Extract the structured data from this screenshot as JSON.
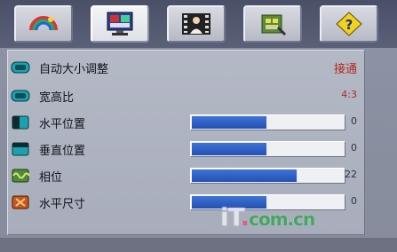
{
  "tabs": [
    {
      "name": "color",
      "icon": "color-wheel-icon",
      "active": false
    },
    {
      "name": "image",
      "icon": "monitor-icon",
      "active": true
    },
    {
      "name": "video",
      "icon": "film-person-icon",
      "active": false
    },
    {
      "name": "setup",
      "icon": "settings-chip-icon",
      "active": false
    },
    {
      "name": "help",
      "icon": "help-question-icon",
      "active": false
    }
  ],
  "rows": [
    {
      "label": "自动大小调整",
      "icon": "auto-resize-icon",
      "value": "接通"
    },
    {
      "label": "宽高比",
      "icon": "aspect-ratio-icon",
      "value": "4:3"
    },
    {
      "label": "水平位置",
      "icon": "h-position-icon",
      "value": "0",
      "level": 0.49
    },
    {
      "label": "垂直位置",
      "icon": "v-position-icon",
      "value": "0",
      "level": 0.49
    },
    {
      "label": "相位",
      "icon": "phase-icon",
      "value": "22",
      "level": 0.69
    },
    {
      "label": "水平尺寸",
      "icon": "h-size-icon",
      "value": "0",
      "level": 0.49
    }
  ],
  "watermark": {
    "main": "iT",
    "dot": ".",
    "com": "com",
    "cn": ".cn"
  },
  "colors": {
    "bar_fill": "#2a58c0",
    "accent_red": "#b3261e",
    "panel": "#b0b5c2"
  }
}
